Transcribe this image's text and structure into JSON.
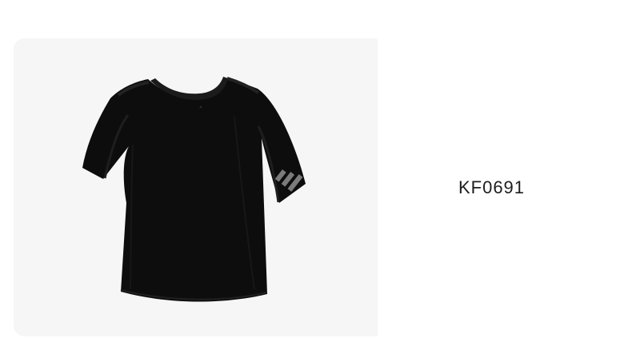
{
  "product": {
    "code": "KF0691",
    "image_name": "black-cropped-tshirt-image"
  },
  "colors": {
    "image_background": "#f6f6f6",
    "shirt": "#0d0d0d",
    "logo": "#7b7b7b"
  }
}
